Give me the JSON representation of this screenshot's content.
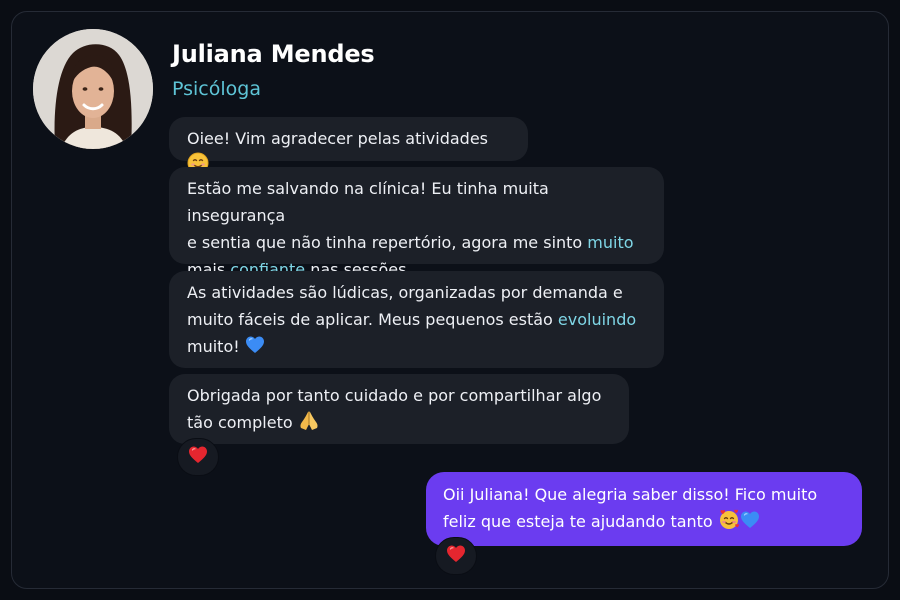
{
  "contact": {
    "name": "Juliana Mendes",
    "role": "Psicóloga"
  },
  "messages": [
    {
      "segments": [
        "Oiee! Vim agradecer pelas atividades"
      ],
      "emoji": "smiling-face-emoji"
    },
    {
      "line1": "Estão me salvando na clínica! Eu tinha muita insegurança",
      "line2_a": "e sentia que não tinha repertório, agora me sinto ",
      "line2_hl": "muito",
      "line3_a": "mais ",
      "line3_hl": "confiante",
      "line3_b": " nas sessões."
    },
    {
      "line1": "As atividades são lúdicas, organizadas por demanda e",
      "line2_a": "muito fáceis de aplicar. Meus pequenos estão ",
      "line2_hl": "evoluindo",
      "line3_a": "muito! ",
      "emoji": "blue-heart-emoji"
    },
    {
      "line1": "Obrigada por tanto cuidado e por compartilhar algo",
      "line2_a": "tão completo ",
      "emoji": "folded-hands-emoji",
      "reaction": "red-heart-emoji"
    }
  ],
  "reply": {
    "line1": "Oii Juliana! Que alegria saber disso! Fico muito",
    "line2_a": "feliz que esteja te ajudando tanto ",
    "emojis": [
      "smiling-face-with-hearts-emoji",
      "blue-heart-emoji"
    ],
    "reaction": "red-heart-emoji"
  },
  "colors": {
    "background": "#0a0d14",
    "incoming_bubble": "#1c2028",
    "outgoing_bubble": "#6b3cf0",
    "highlight": "#7fd6e6",
    "role": "#5ec4d6"
  }
}
